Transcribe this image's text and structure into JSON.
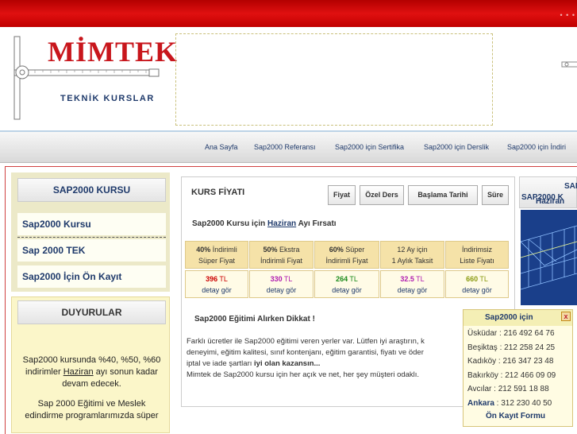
{
  "header": {
    "brand": "MİMTEK",
    "subtitle": "TEKNİK KURSLAR",
    "right_logo_fragment": "SAP",
    "top_dots": "• • •"
  },
  "nav": {
    "items": [
      "Ana Sayfa",
      "Sap2000 Referansı",
      "Sap2000 için Sertifika",
      "Sap2000 için Derslik",
      "Sap2000 için İndiri"
    ]
  },
  "sidebar": {
    "heading": "SAP2000 KURSU",
    "items": [
      "Sap2000 Kursu",
      "Sap 2000 TEK",
      "Sap2000 İçin Ön Kayıt"
    ]
  },
  "announcements": {
    "heading": "DUYURULAR",
    "text_before": "Sap2000 kursunda %40, %50, %60 indirimler",
    "month_link": "Haziran",
    "text_after": "ayı sonun kadar devam edecek.",
    "text2_l1": "Sap 2000 Eğitimi ve Meslek",
    "text2_l2": "edindirme programlarımızda süper"
  },
  "main": {
    "title": "KURS FİYATI",
    "tabs": [
      "Fiyat",
      "Özel Ders",
      "Başlama Tarihi",
      "Süre"
    ],
    "promo_before": "Sap2000 Kursu için",
    "promo_month": "Haziran",
    "promo_after": "Ayı Fırsatı",
    "prices": [
      {
        "pct": "40%",
        "l1": "İndirimli",
        "l2": "Süper Fiyat",
        "value": "396",
        "unit": "TL",
        "link": "detay gör",
        "color": "#cc0000"
      },
      {
        "pct": "50%",
        "l1": "Ekstra",
        "l2": "İndirimli Fiyat",
        "value": "330",
        "unit": "TL",
        "link": "detay gör",
        "color": "#b01cb0"
      },
      {
        "pct": "60%",
        "l1": "Süper",
        "l2": "İndirimli Fiyat",
        "value": "264",
        "unit": "TL",
        "link": "detay gör",
        "color": "#1a8a1a"
      },
      {
        "pct": "",
        "l1": "12 Ay için",
        "l2": "1 Aylık Taksit",
        "value": "32.5",
        "unit": "TL",
        "link": "detay gör",
        "color": "#b01cb0"
      },
      {
        "pct": "",
        "l1": "İndirimsiz",
        "l2": "Liste Fiyatı",
        "value": "660",
        "unit": "TL",
        "link": "detay gör",
        "color": "#8a9a10"
      }
    ],
    "notice_title": "Sap2000 Eğitimi Alırken Dikkat !",
    "para_l1": "Farklı ücretler ile Sap2000 eğitimi veren yerler var. Lütfen iyi araştırın, k",
    "para_l2": "deneyimi, eğitim kalitesi, sınıf kontenjanı, eğitim garantisi, fiyatı ve öder",
    "para_l3_a": "iptal ve iade şartları",
    "para_l3_b": "iyi olan kazansın...",
    "para_l4": "Mimtek de Sap2000 kursu için her açık ve net, her şey müşteri odaklı."
  },
  "right": {
    "l1": "SAP",
    "l2": "SAP2000 K",
    "l3": "Haziran"
  },
  "popup": {
    "title": "Sap2000 için",
    "close": "x",
    "rows": [
      {
        "place": "Üsküdar",
        "phone": "216 492 64 76"
      },
      {
        "place": "Beşiktaş",
        "phone": "212 258 24 25"
      },
      {
        "place": "Kadıköy",
        "phone": "216 347 23 48"
      },
      {
        "place": "Bakırköy",
        "phone": "212 466 09 09"
      },
      {
        "place": "Avcılar",
        "phone": "212 591 18 88"
      },
      {
        "place": "Ankara",
        "phone": "312 230 40 50"
      }
    ],
    "form_link": "Ön Kayıt Formu"
  }
}
